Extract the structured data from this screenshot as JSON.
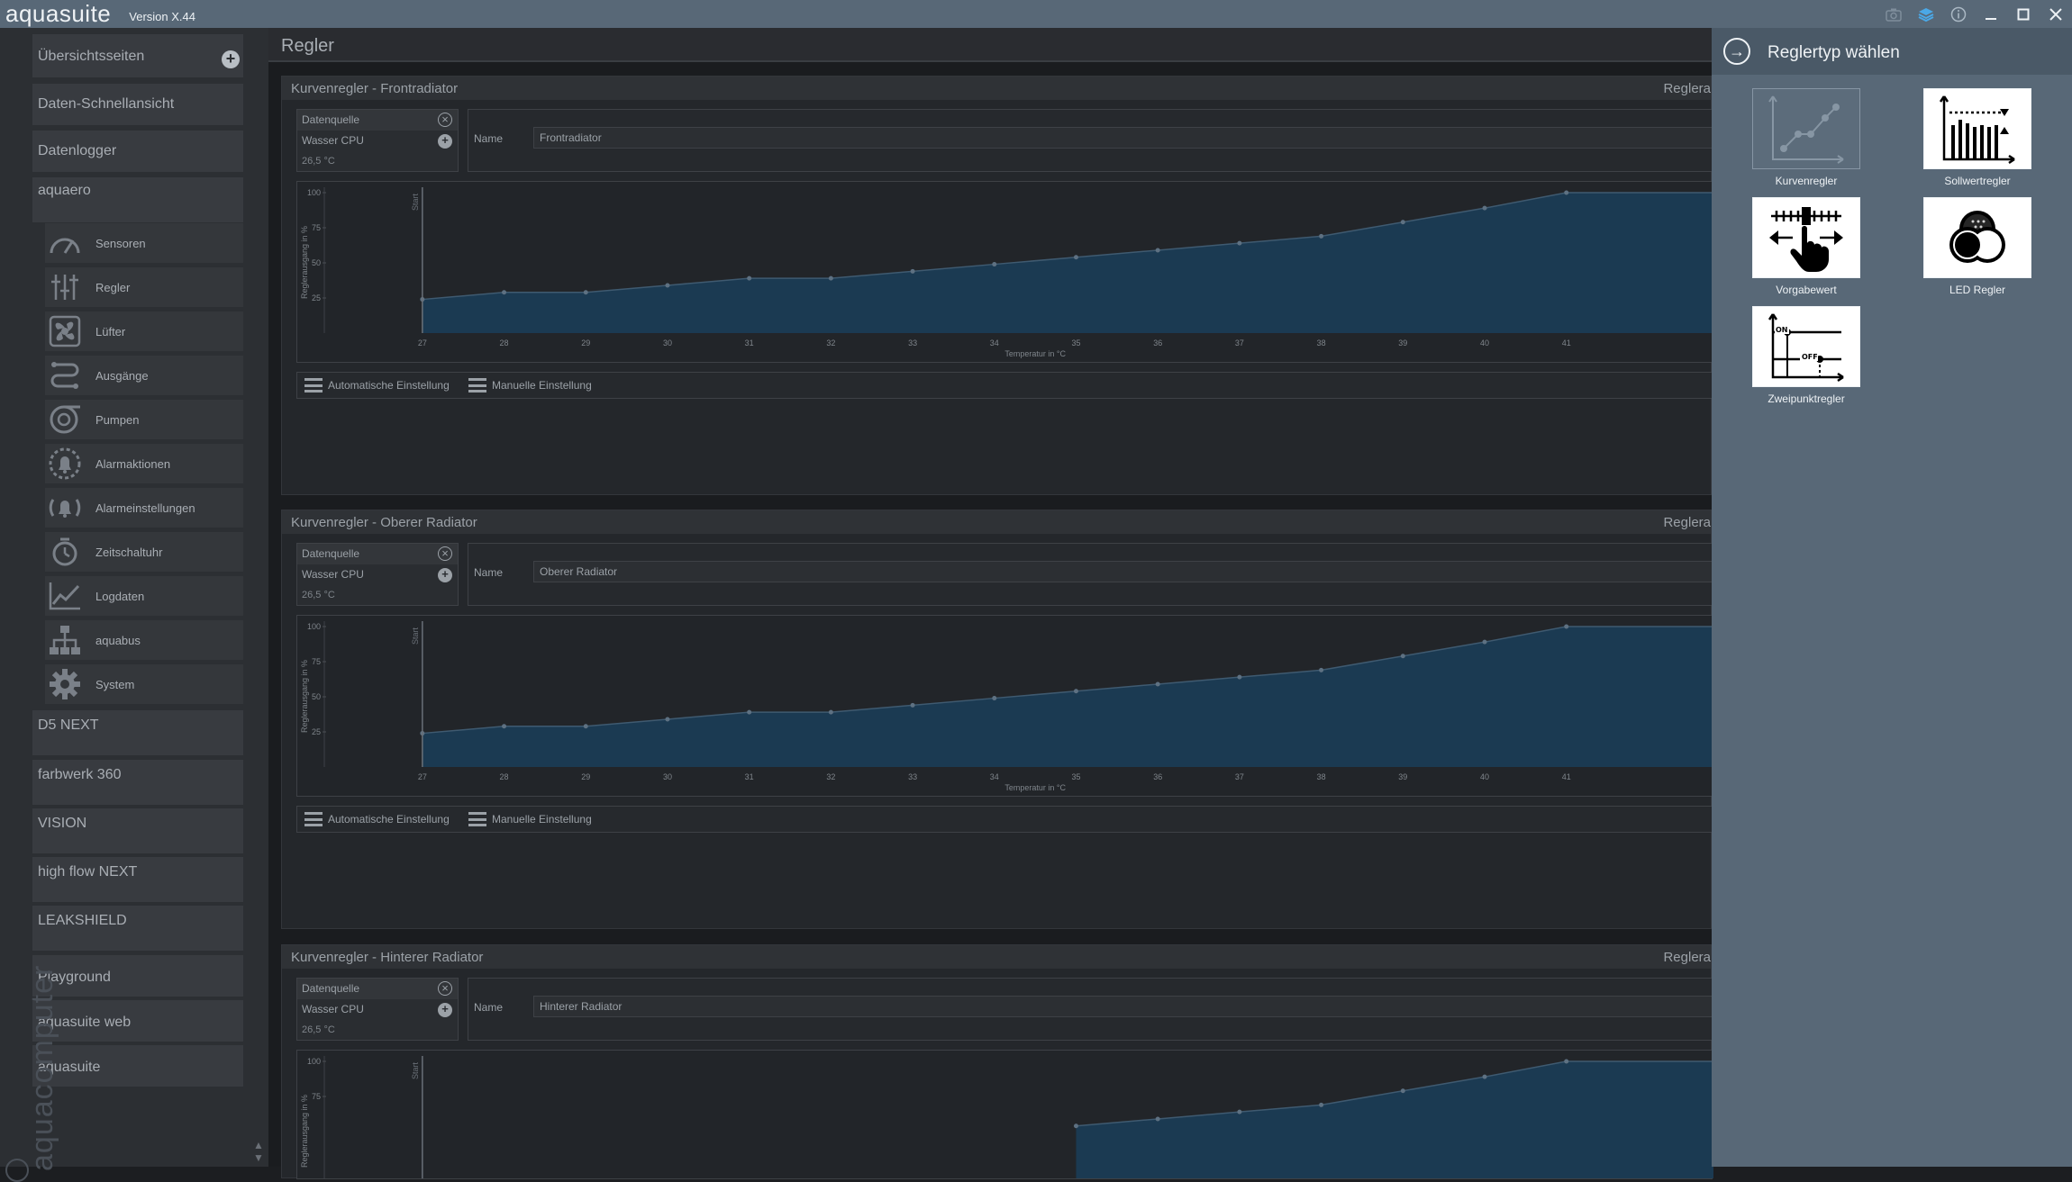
{
  "app": {
    "logo": "aquasuite",
    "version": "Version X.44",
    "brand_vertical": "aquacomputer"
  },
  "titlebar_icons": [
    "camera-icon",
    "layers-icon",
    "info-icon",
    "minimize-icon",
    "maximize-icon",
    "close-icon"
  ],
  "sidebar": {
    "groups": [
      {
        "label": "Übersichtsseiten"
      },
      {
        "label": "Daten-Schnellansicht"
      },
      {
        "label": "Datenlogger"
      },
      {
        "label": "aquaero"
      }
    ],
    "aquaero_items": [
      {
        "label": "Sensoren",
        "icon": "gauge-icon"
      },
      {
        "label": "Regler",
        "icon": "sliders-icon"
      },
      {
        "label": "Lüfter",
        "icon": "fan-icon"
      },
      {
        "label": "Ausgänge",
        "icon": "outputs-icon"
      },
      {
        "label": "Pumpen",
        "icon": "pump-icon"
      },
      {
        "label": "Alarmaktionen",
        "icon": "alarm-bell-icon"
      },
      {
        "label": "Alarmeinstellungen",
        "icon": "alarm-settings-icon"
      },
      {
        "label": "Zeitschaltuhr",
        "icon": "timer-icon"
      },
      {
        "label": "Logdaten",
        "icon": "chart-line-icon"
      },
      {
        "label": "aquabus",
        "icon": "network-icon"
      },
      {
        "label": "System",
        "icon": "gear-icon"
      }
    ],
    "devices": [
      {
        "label": "D5 NEXT"
      },
      {
        "label": "farbwerk 360"
      },
      {
        "label": "VISION"
      },
      {
        "label": "high flow NEXT"
      },
      {
        "label": "LEAKSHIELD"
      },
      {
        "label": "Playground"
      },
      {
        "label": "aquasuite web"
      },
      {
        "label": "aquasuite"
      }
    ]
  },
  "main": {
    "title": "Regler",
    "panels": [
      {
        "title": "Kurvenregler  -  Frontradiator",
        "right": "Reglera",
        "ds_header": "Datenquelle",
        "ds_source": "Wasser CPU",
        "ds_value": "26,5 °C",
        "name_label": "Name",
        "name_value": "Frontradiator",
        "auto_label": "Automatische Einstellung",
        "manual_label": "Manuelle Einstellung"
      },
      {
        "title": "Kurvenregler  -  Oberer Radiator",
        "right": "Reglera",
        "ds_header": "Datenquelle",
        "ds_source": "Wasser CPU",
        "ds_value": "26,5 °C",
        "name_label": "Name",
        "name_value": "Oberer Radiator",
        "auto_label": "Automatische Einstellung",
        "manual_label": "Manuelle Einstellung"
      },
      {
        "title": "Kurvenregler  -  Hinterer Radiator",
        "right": "Reglera",
        "ds_header": "Datenquelle",
        "ds_source": "Wasser CPU",
        "ds_value": "26,5 °C",
        "name_label": "Name",
        "name_value": "Hinterer Radiator"
      }
    ]
  },
  "chart_data": [
    {
      "type": "area",
      "ylabel": "Reglerausgang in %",
      "xlabel": "Temperatur in °C",
      "marker_label": "Start",
      "yticks": [
        100,
        75,
        50,
        25
      ],
      "xticks": [
        27,
        28,
        29,
        30,
        31,
        32,
        33,
        34,
        35,
        36,
        37,
        38,
        39,
        40,
        41
      ],
      "xlim": [
        25.8,
        42.8
      ],
      "ylim": [
        0,
        100
      ],
      "start_x": 27,
      "x": [
        27,
        28,
        29,
        30,
        31,
        32,
        33,
        34,
        35,
        36,
        37,
        38,
        39,
        40,
        41,
        41.7
      ],
      "y": [
        24,
        29,
        29,
        34,
        39,
        39,
        44,
        49,
        54,
        59,
        64,
        69,
        79,
        89,
        100,
        100
      ],
      "color": "#1b3a52",
      "line_color": "#3f5a70"
    },
    {
      "type": "area",
      "ylabel": "Reglerausgang in %",
      "xlabel": "Temperatur in °C",
      "marker_label": "Start",
      "yticks": [
        100,
        75,
        50,
        25
      ],
      "xticks": [
        27,
        28,
        29,
        30,
        31,
        32,
        33,
        34,
        35,
        36,
        37,
        38,
        39,
        40,
        41
      ],
      "xlim": [
        25.8,
        42.8
      ],
      "ylim": [
        0,
        100
      ],
      "start_x": 27,
      "x": [
        27,
        28,
        29,
        30,
        31,
        32,
        33,
        34,
        35,
        36,
        37,
        38,
        39,
        40,
        41,
        41.7
      ],
      "y": [
        24,
        29,
        29,
        34,
        39,
        39,
        44,
        49,
        54,
        59,
        64,
        69,
        79,
        89,
        100,
        100
      ],
      "color": "#1b3a52",
      "line_color": "#3f5a70"
    },
    {
      "type": "area",
      "ylabel": "Reglerausgang in %",
      "marker_label": "Start",
      "yticks": [
        100,
        75
      ],
      "xlim": [
        25.8,
        42.8
      ],
      "ylim": [
        0,
        100
      ],
      "start_x": 27,
      "x": [
        35,
        36,
        37,
        38,
        39,
        40,
        41,
        41.7
      ],
      "y": [
        54,
        59,
        64,
        69,
        79,
        89,
        100,
        100
      ],
      "color": "#1b3a52",
      "line_color": "#3f5a70"
    }
  ],
  "right_panel": {
    "title": "Reglertyp wählen",
    "tiles": [
      {
        "label": "Kurvenregler",
        "icon": "curve-controller-icon",
        "enabled": false
      },
      {
        "label": "Sollwertregler",
        "icon": "setpoint-controller-icon",
        "enabled": true
      },
      {
        "label": "Vorgabewert",
        "icon": "preset-value-icon",
        "enabled": true
      },
      {
        "label": "LED Regler",
        "icon": "led-controller-icon",
        "enabled": true
      },
      {
        "label": "Zweipunktregler",
        "icon": "two-point-controller-icon",
        "enabled": true
      }
    ]
  }
}
